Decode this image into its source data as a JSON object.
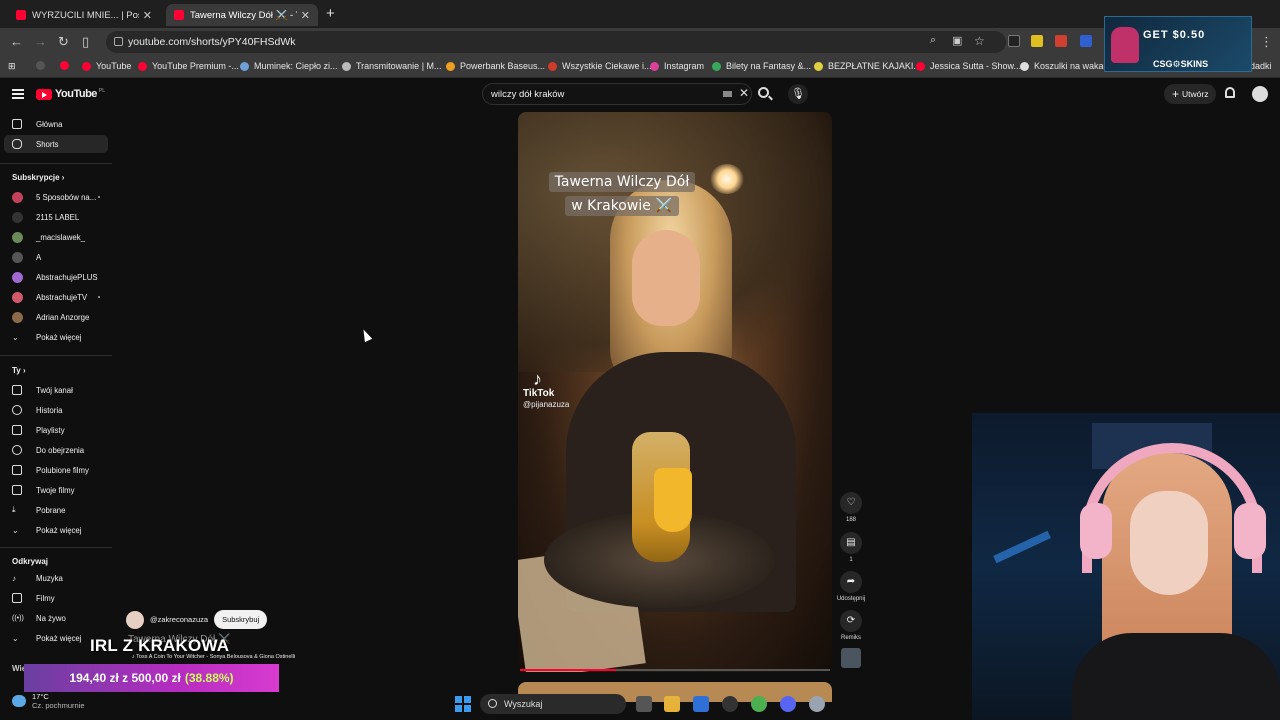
{
  "browser": {
    "tabs": [
      {
        "title": "WYRZUCILI MNIE... | Poszukiwa",
        "active": false
      },
      {
        "title": "Tawerna Wilczy Dół ⚔️ - YouTu",
        "active": true
      }
    ],
    "new_tab": "+",
    "url": "youtube.com/shorts/yPY40FHSdWk",
    "bookmarks": [
      "YouTube",
      "YouTube Premium -...",
      "Muminek: Ciepło zi...",
      "Transmitowanie | M...",
      "Powerbank Baseus...",
      "Wszystkie Ciekawe i...",
      "Instagram",
      "Bilety na Fantasy &...",
      "BEZPŁATNE KAJAKI...",
      "Jessica Sutta - Show...",
      "Koszulki na wakacje...",
      "dadki"
    ],
    "ad": {
      "headline": "GET $0.50",
      "brand": "CSG⚙SKINS"
    }
  },
  "header": {
    "logo": "YouTube",
    "country": "PL",
    "search_value": "wilczy dół kraków",
    "create_label": "Utwórz"
  },
  "sidebar": {
    "main": [
      {
        "label": "Główna"
      },
      {
        "label": "Shorts"
      }
    ],
    "subs_heading": "Subskrypcje",
    "subs": [
      {
        "label": "5 Sposobów na...",
        "color": "#c2425b"
      },
      {
        "label": "2115 LABEL",
        "color": "#333333"
      },
      {
        "label": "_macislawek_",
        "color": "#6b8a5a"
      },
      {
        "label": "A",
        "color": "#555555"
      },
      {
        "label": "AbstrachujePLUS",
        "color": "#a06ad0"
      },
      {
        "label": "AbstrachujeTV",
        "color": "#d05a6a"
      },
      {
        "label": "Adrian Anzorge",
        "color": "#8a6a4a"
      },
      {
        "label": "Pokaż więcej"
      }
    ],
    "you_heading": "Ty",
    "you": [
      {
        "label": "Twój kanał"
      },
      {
        "label": "Historia"
      },
      {
        "label": "Playlisty"
      },
      {
        "label": "Do obejrzenia"
      },
      {
        "label": "Polubione filmy"
      },
      {
        "label": "Twoje filmy"
      },
      {
        "label": "Pobrane"
      },
      {
        "label": "Pokaż więcej"
      }
    ],
    "explore_heading": "Odkrywaj",
    "explore": [
      {
        "label": "Muzyka"
      },
      {
        "label": "Filmy"
      },
      {
        "label": "Na żywo"
      },
      {
        "label": "Pokaż więcej"
      }
    ],
    "more_heading": "Więcej z YouTube"
  },
  "short": {
    "caption_line1": "Tawerna Wilczy Dół",
    "caption_line2": "w Krakowie ⚔️",
    "watermark_brand": "TikTok",
    "watermark_handle": "@pijanazuza",
    "progress": 0.31,
    "channel": "@zakreconazuza",
    "subscribe_label": "Subskrybuj",
    "title_partial": "Tawerna Wilczy Dół ⚔️",
    "likes": "188",
    "comments": "1",
    "share_label": "Udostępnij",
    "remix_label": "Remiks"
  },
  "stream": {
    "irl_title": "IRL Z KRAKOWA",
    "song": "♪ Toss A Coin To Your Witcher - Sonya Belousova & Giona Ostinelli",
    "goal_amount": "194,40 zł",
    "goal_sep": "z",
    "goal_target": "500,00 zł",
    "goal_percent": "(38.88%)"
  },
  "taskbar": {
    "temp": "17°C",
    "weather": "Cz. pochmurnie",
    "search_placeholder": "Wyszukaj"
  }
}
